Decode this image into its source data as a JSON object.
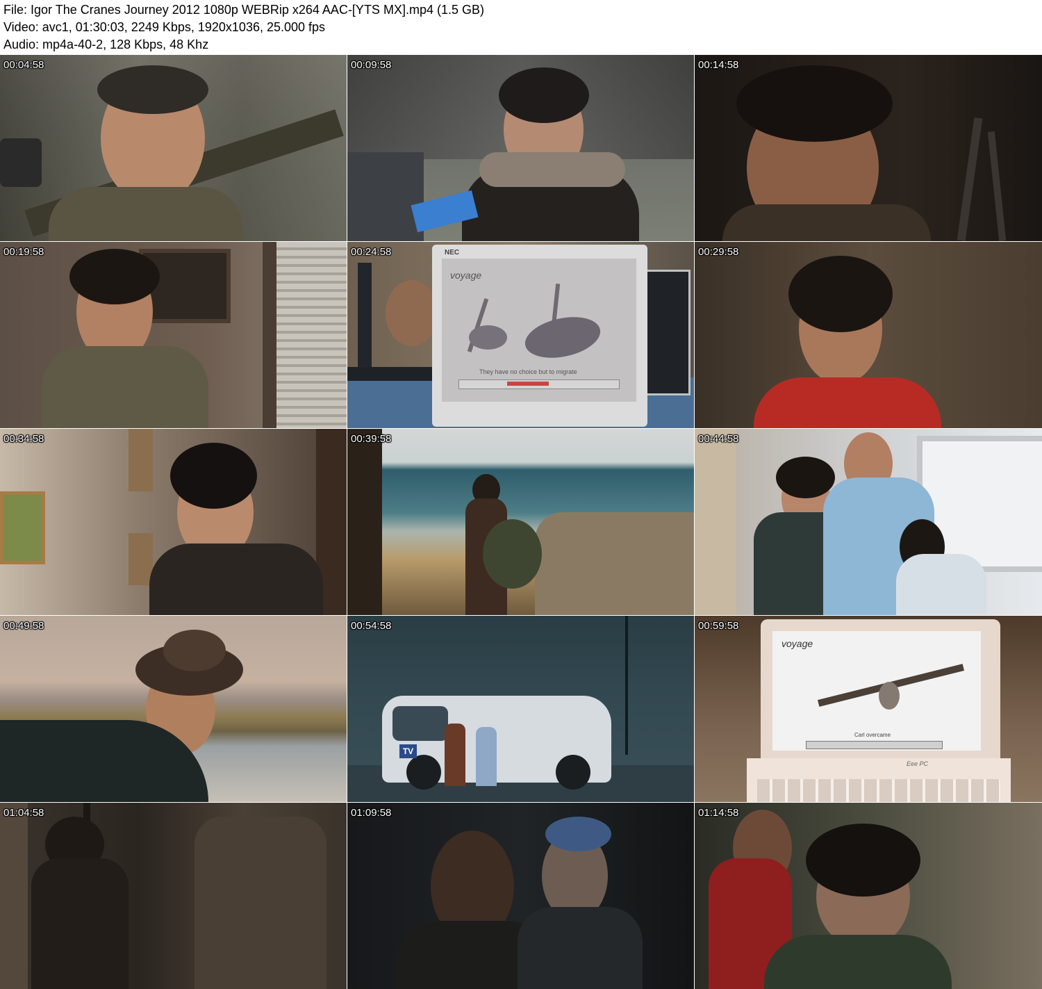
{
  "header": {
    "file_line": "File: Igor The Cranes Journey 2012 1080p WEBRip x264 AAC-[YTS MX].mp4 (1.5 GB)",
    "video_line": "Video: avc1, 01:30:03, 2249 Kbps, 1920x1036, 25.000 fps",
    "audio_line": "Audio: mp4a-40-2, 128 Kbps, 48 Khz"
  },
  "thumbnails": [
    {
      "timestamp": "00:04:58"
    },
    {
      "timestamp": "00:09:58"
    },
    {
      "timestamp": "00:14:58"
    },
    {
      "timestamp": "00:19:58"
    },
    {
      "timestamp": "00:24:58"
    },
    {
      "timestamp": "00:29:58"
    },
    {
      "timestamp": "00:34:58"
    },
    {
      "timestamp": "00:39:58"
    },
    {
      "timestamp": "00:44:58"
    },
    {
      "timestamp": "00:49:58"
    },
    {
      "timestamp": "00:54:58"
    },
    {
      "timestamp": "00:59:58"
    },
    {
      "timestamp": "01:04:58"
    },
    {
      "timestamp": "01:09:58"
    },
    {
      "timestamp": "01:14:58"
    }
  ],
  "screen_captions": {
    "t5_subtitle": "They have no choice but to migrate",
    "t12_subtitle": "Carl overcame",
    "t12_logo": "voyage",
    "t5_logo": "voyage",
    "t5_brand": "NEC",
    "t12_brand": "Eee PC"
  }
}
